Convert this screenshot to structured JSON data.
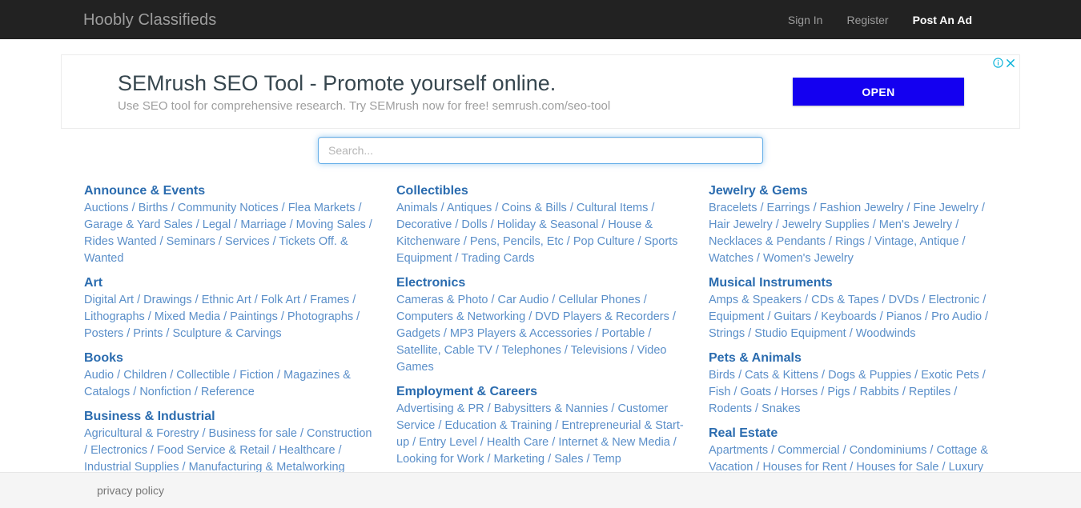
{
  "navbar": {
    "brand": "Hoobly Classifieds",
    "links": [
      {
        "label": "Sign In",
        "active": false
      },
      {
        "label": "Register",
        "active": false
      },
      {
        "label": "Post An Ad",
        "active": true
      }
    ]
  },
  "ad": {
    "headline": "SEMrush SEO Tool - Promote yourself online.",
    "subtext": "Use SEO tool for comprehensive research. Try SEMrush now for free! semrush.com/seo-tool",
    "button_label": "OPEN",
    "info_icon": "info-icon",
    "close_icon": "close-icon",
    "accent_color": "#1400f0",
    "control_color": "#00b0d8"
  },
  "search": {
    "placeholder": "Search...",
    "value": "",
    "focused": true
  },
  "columns": [
    {
      "categories": [
        {
          "title": "Announce & Events",
          "links": [
            "Auctions",
            "Births",
            "Community Notices",
            "Flea Markets",
            "Garage & Yard Sales",
            "Legal",
            "Marriage",
            "Moving Sales",
            "Rides Wanted",
            "Seminars",
            "Services",
            "Tickets Off. & Wanted"
          ]
        },
        {
          "title": "Art",
          "links": [
            "Digital Art",
            "Drawings",
            "Ethnic Art",
            "Folk Art",
            "Frames",
            "Lithographs",
            "Mixed Media",
            "Paintings",
            "Photographs",
            "Posters",
            "Prints",
            "Sculpture & Carvings"
          ]
        },
        {
          "title": "Books",
          "links": [
            "Audio",
            "Children",
            "Collectible",
            "Fiction",
            "Magazines & Catalogs",
            "Nonfiction",
            "Reference"
          ]
        },
        {
          "title": "Business & Industrial",
          "links": [
            "Agricultural & Forestry",
            "Business for sale",
            "Construction",
            "Electronics",
            "Food Service & Retail",
            "Healthcare",
            "Industrial Supplies",
            "Manufacturing & Metalworking"
          ]
        }
      ]
    },
    {
      "categories": [
        {
          "title": "Collectibles",
          "links": [
            "Animals",
            "Antiques",
            "Coins & Bills",
            "Cultural Items",
            "Decorative",
            "Dolls",
            "Holiday & Seasonal",
            "House & Kitchenware",
            "Pens, Pencils, Etc",
            "Pop Culture",
            "Sports Equipment",
            "Trading Cards"
          ]
        },
        {
          "title": "Electronics",
          "links": [
            "Cameras & Photo",
            "Car Audio",
            "Cellular Phones",
            "Computers & Networking",
            "DVD Players & Recorders",
            "Gadgets",
            "MP3 Players & Accessories",
            "Portable",
            "Satellite, Cable TV",
            "Telephones",
            "Televisions",
            "Video Games"
          ]
        },
        {
          "title": "Employment & Careers",
          "links": [
            "Advertising & PR",
            "Babysitters & Nannies",
            "Customer Service",
            "Education & Training",
            "Entrepreneurial & Start-up",
            "Entry Level",
            "Health Care",
            "Internet & New Media",
            "Looking for Work",
            "Marketing",
            "Sales",
            "Temp"
          ]
        }
      ]
    },
    {
      "categories": [
        {
          "title": "Jewelry & Gems",
          "links": [
            "Bracelets",
            "Earrings",
            "Fashion Jewelry",
            "Fine Jewelry",
            "Hair Jewelry",
            "Jewelry Supplies",
            "Men's Jewelry",
            "Necklaces & Pendants",
            "Rings",
            "Vintage, Antique",
            "Watches",
            "Women's Jewelry"
          ]
        },
        {
          "title": "Musical Instruments",
          "links": [
            "Amps & Speakers",
            "CDs & Tapes",
            "DVDs",
            "Electronic",
            "Equipment",
            "Guitars",
            "Keyboards",
            "Pianos",
            "Pro Audio",
            "Strings",
            "Studio Equipment",
            "Woodwinds"
          ]
        },
        {
          "title": "Pets & Animals",
          "links": [
            "Birds",
            "Cats & Kittens",
            "Dogs & Puppies",
            "Exotic Pets",
            "Fish",
            "Goats",
            "Horses",
            "Pigs",
            "Rabbits",
            "Reptiles",
            "Rodents",
            "Snakes"
          ]
        },
        {
          "title": "Real Estate",
          "links": [
            "Apartments",
            "Commercial",
            "Condominiums",
            "Cottage & Vacation",
            "Houses for Rent",
            "Houses for Sale",
            "Luxury"
          ]
        }
      ]
    }
  ],
  "footer": {
    "privacy_label": "privacy policy"
  }
}
